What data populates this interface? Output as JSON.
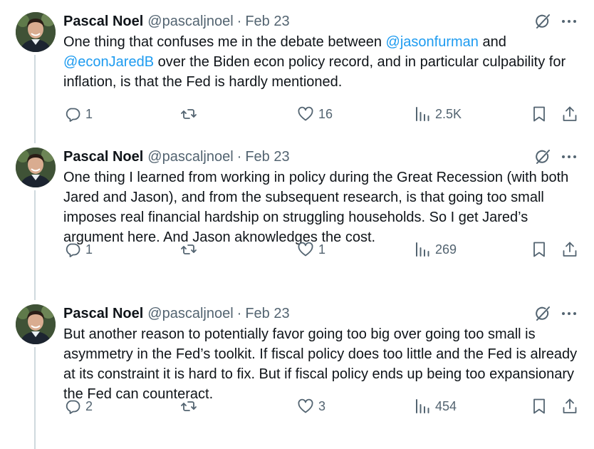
{
  "tweets": [
    {
      "display_name": "Pascal Noel",
      "handle": "@pascaljnoel",
      "separator": "·",
      "date": "Feb 23",
      "text_parts": [
        {
          "type": "text",
          "value": "One thing that confuses me in the debate between "
        },
        {
          "type": "mention",
          "value": "@jasonfurman"
        },
        {
          "type": "text",
          "value": " and "
        },
        {
          "type": "mention",
          "value": "@econJaredB"
        },
        {
          "type": "text",
          "value": " over the Biden econ policy record, and in particular culpability for inflation, is that the Fed is hardly mentioned."
        }
      ],
      "replies": "1",
      "retweets": "",
      "likes": "16",
      "views": "2.5K"
    },
    {
      "display_name": "Pascal Noel",
      "handle": "@pascaljnoel",
      "separator": "·",
      "date": "Feb 23",
      "text_parts": [
        {
          "type": "text",
          "value": "One thing I learned from working in policy during the Great Recession (with both Jared and Jason), and from the subsequent research, is that going too small imposes real financial hardship on struggling households. So I get Jared’s argument here. And Jason aknowledges the cost."
        }
      ],
      "replies": "1",
      "retweets": "",
      "likes": "1",
      "views": "269"
    },
    {
      "display_name": "Pascal Noel",
      "handle": "@pascaljnoel",
      "separator": "·",
      "date": "Feb 23",
      "text_parts": [
        {
          "type": "text",
          "value": "But another reason to potentially favor going too big over going too small is asymmetry in the Fed’s toolkit. If fiscal policy does too little and the Fed is already at its constraint it is hard to fix. But if fiscal policy ends up being too expansionary the Fed can counteract."
        }
      ],
      "replies": "2",
      "retweets": "",
      "likes": "3",
      "views": "454"
    }
  ],
  "icons": {
    "reply": "reply-icon",
    "retweet": "retweet-icon",
    "like": "heart-icon",
    "views": "views-icon",
    "bookmark": "bookmark-icon",
    "share": "share-icon",
    "grok": "grok-icon",
    "more": "more-icon"
  },
  "colors": {
    "text": "#0f1419",
    "secondary": "#536471",
    "link": "#1d9bf0",
    "thread_line": "#cfd9de"
  }
}
